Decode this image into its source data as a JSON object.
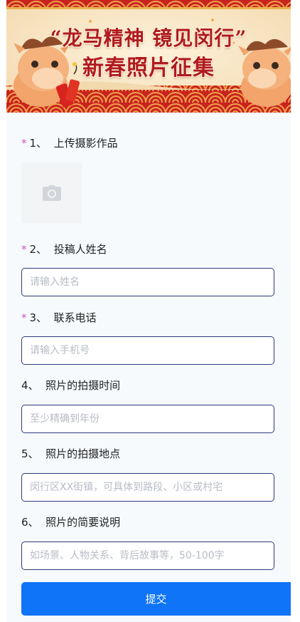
{
  "banner": {
    "title_line1": "“龙马精神 镜见闵行”",
    "title_line2": "新春照片征集"
  },
  "questions": {
    "q1": {
      "number": "1、",
      "label": "上传摄影作品",
      "required": true
    },
    "q2": {
      "number": "2、",
      "label": "投稿人姓名",
      "required": true,
      "placeholder": "请输入姓名"
    },
    "q3": {
      "number": "3、",
      "label": "联系电话",
      "required": true,
      "placeholder": "请输入手机号"
    },
    "q4": {
      "number": "4、",
      "label": "照片的拍摄时间",
      "required": false,
      "placeholder": "至少精确到年份"
    },
    "q5": {
      "number": "5、",
      "label": "照片的拍摄地点",
      "required": false,
      "placeholder": "闵行区XX街镇，可具体到路段、小区或村宅"
    },
    "q6": {
      "number": "6、",
      "label": "照片的简要说明",
      "required": false,
      "placeholder": "如场景、人物关系、背后故事等，50-100字"
    }
  },
  "required_mark": "*",
  "submit_label": "提交",
  "icons": {
    "upload": "camera-icon"
  },
  "colors": {
    "accent": "#0f74f8",
    "required_star": "#c957c8",
    "field_border": "#2e3a7a",
    "banner_red": "#b01b20"
  }
}
